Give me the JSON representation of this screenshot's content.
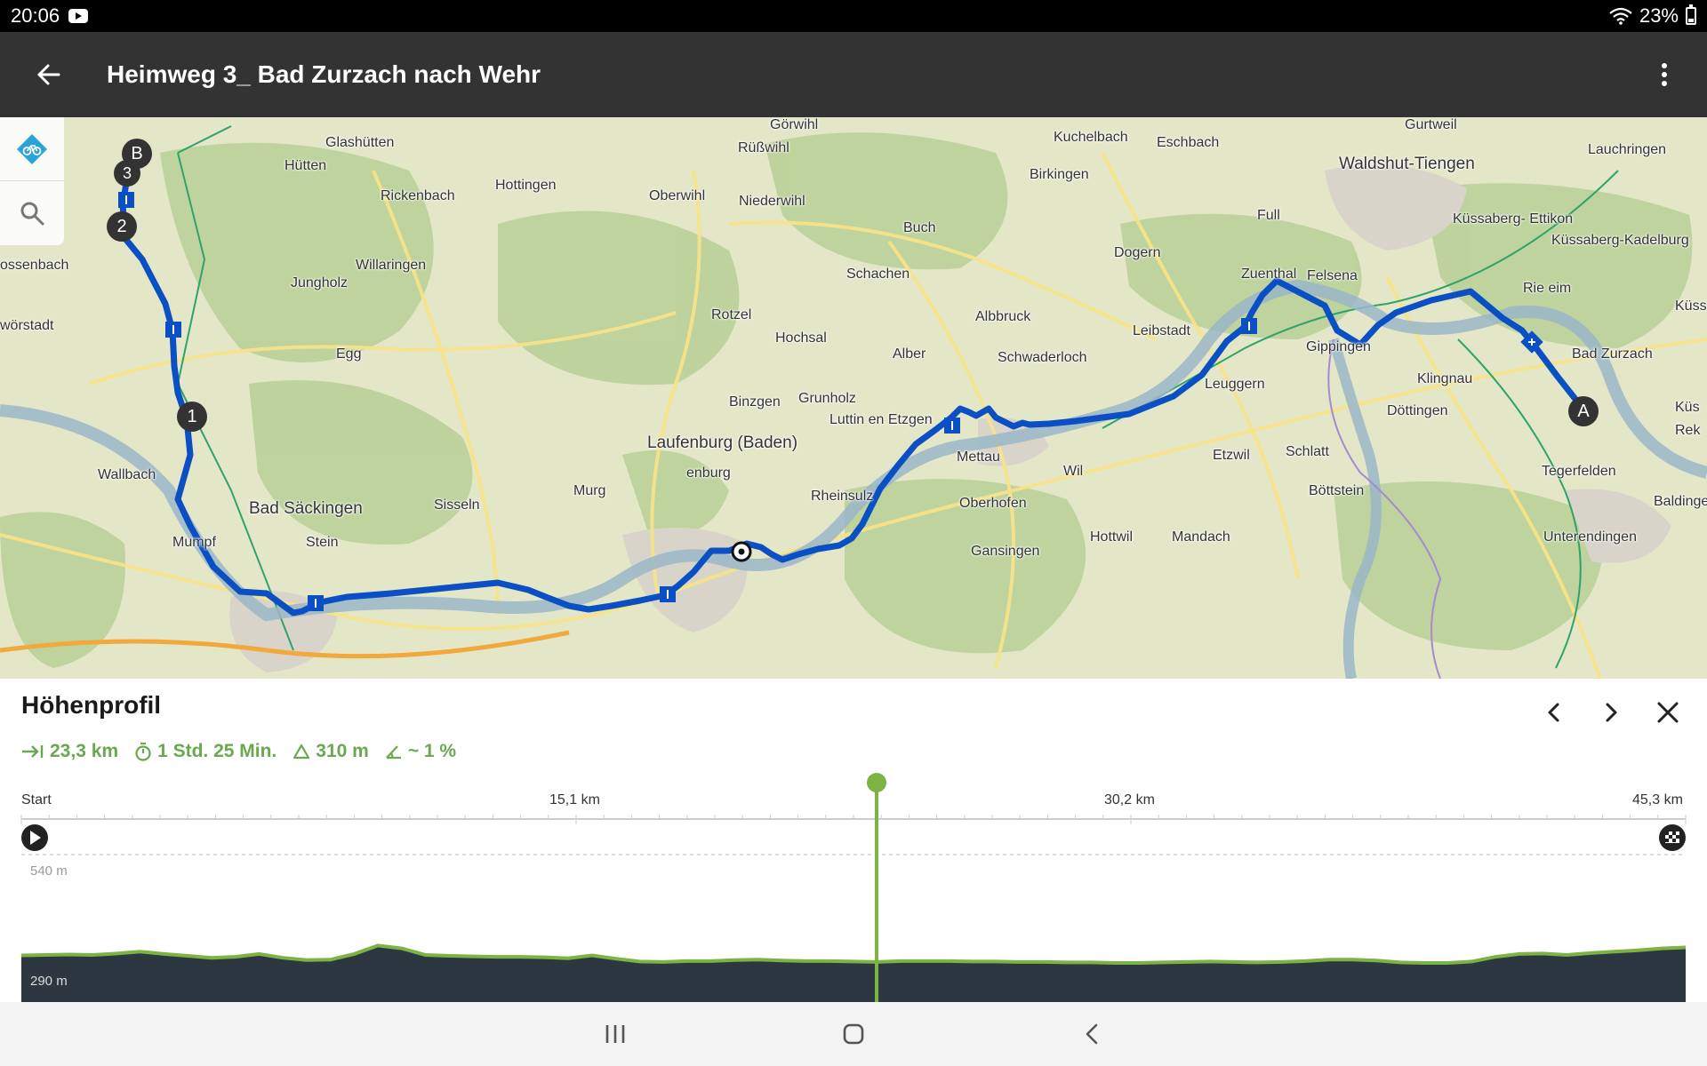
{
  "status_bar": {
    "time": "20:06",
    "battery_percent": "23%",
    "battery_level": 0.23
  },
  "app_bar": {
    "title": "Heimweg 3_ Bad Zurzach nach Wehr",
    "back_icon": "arrow-back-icon",
    "menu_icon": "more-vert-icon"
  },
  "map": {
    "controls": [
      {
        "name": "bike-route-icon"
      },
      {
        "name": "search-icon"
      }
    ],
    "markers": {
      "start": "A",
      "end": "B",
      "waypoints": [
        "1",
        "2",
        "3"
      ]
    },
    "place_labels": [
      "Görwihl",
      "Gurtweil",
      "Glashütten",
      "Kuchelbach",
      "Eschbach",
      "Lauchringen",
      "Rüßwihl",
      "Waldshut-Tiengen",
      "Hütten",
      "Birkingen",
      "Hottingen",
      "Rickenbach",
      "Oberwihl",
      "Niederwihl",
      "Full",
      "Küssaberg- Ettikon",
      "Buch",
      "Küssaberg-Kadelburg",
      "ossenbach",
      "Willaringen",
      "Dogern",
      "Jungholz",
      "Schachen",
      "Zuenthal",
      "Felsena",
      "Rie eim",
      "wörstadt",
      "Rotzel",
      "Albbruck",
      "Hochsal",
      "Egg",
      "Alber",
      "Schwaderloch",
      "Gippingen",
      "Bad Zurzach",
      "Leuggern",
      "Klingnau",
      "Grunholz",
      "Binzgen",
      "Döttingen",
      "Luttin en Etzgen",
      "Laufenburg (Baden)",
      "enburg",
      "Etzwil",
      "Schlatt",
      "Mettau",
      "Wallbach",
      "Wil",
      "Tegerfelden",
      "Murg",
      "Rheinsulz",
      "Böttstein",
      "Bad Säckingen",
      "Sisseln",
      "Oberhofen",
      "Baldinge",
      "Mumpf",
      "Stein",
      "Hottwil",
      "Mandach",
      "Unterendingen",
      "Gansingen",
      "Küss Dang",
      "Küs",
      "Rek",
      "Leibstadt"
    ]
  },
  "elevation": {
    "title": "Höhenprofil",
    "stats": {
      "distance": "23,3 km",
      "duration": "1 Std. 25 Min.",
      "ascent": "310 m",
      "gradient": "~ 1 %"
    },
    "axis": {
      "start": "Start",
      "mid1": "15,1 km",
      "mid2": "30,2 km",
      "end": "45,3 km"
    },
    "elev_max": "540 m",
    "elev_min": "290 m",
    "current_position_fraction": 0.514,
    "profile_samples_m": [
      325,
      326,
      327,
      326,
      329,
      333,
      328,
      324,
      320,
      322,
      328,
      320,
      315,
      316,
      328,
      346,
      340,
      326,
      324,
      323,
      322,
      322,
      321,
      319,
      325,
      318,
      312,
      311,
      313,
      313,
      315,
      316,
      314,
      313,
      313,
      312,
      311,
      313,
      313,
      313,
      312,
      312,
      311,
      311,
      310,
      310,
      309,
      309,
      310,
      311,
      312,
      311,
      310,
      311,
      313,
      316,
      316,
      314,
      310,
      309,
      309,
      312,
      322,
      328,
      329,
      326,
      330,
      333,
      336,
      340,
      342
    ],
    "controls": {
      "prev_icon": "chevron-left-icon",
      "next_icon": "chevron-right-icon",
      "close_icon": "close-icon"
    }
  },
  "nav_bar": {
    "recents_icon": "recents-icon",
    "home_icon": "home-icon",
    "back_icon": "back-icon"
  },
  "colors": {
    "route": "#0a4fc4",
    "accent": "#6aa84f",
    "app_bar": "#333333",
    "profile_fill": "#2d3741",
    "profile_line": "#7cb342"
  }
}
